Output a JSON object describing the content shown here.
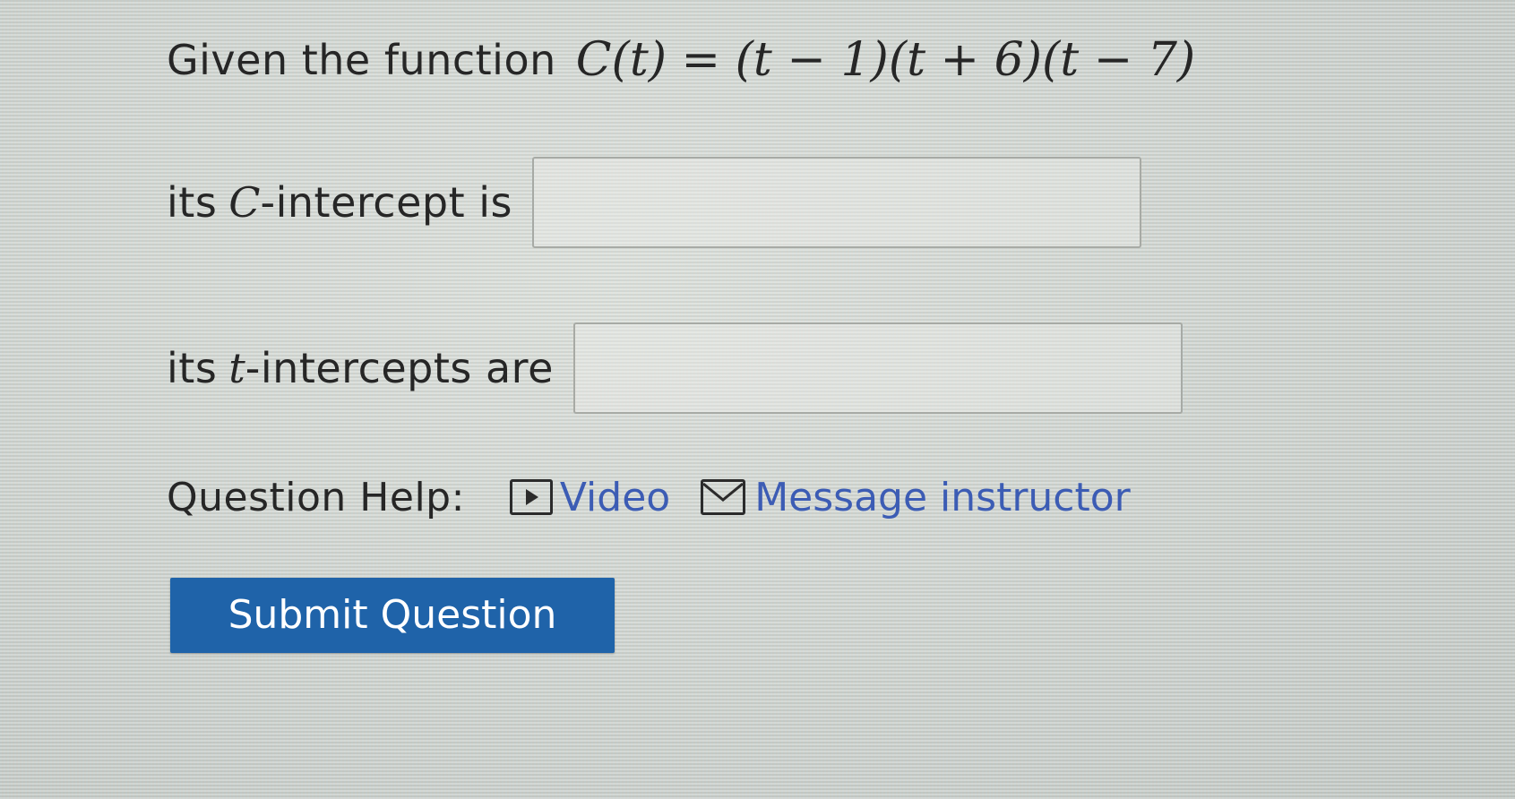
{
  "question": {
    "line1_text": "Given the function",
    "function_expression": "C(t) = (t − 1)(t + 6)(t − 7)",
    "line2_prefix": "its",
    "line2_var": "C",
    "line2_suffix": "-intercept is",
    "line3_prefix": "its",
    "line3_var": "t",
    "line3_suffix": "-intercepts are",
    "c_intercept_value": "",
    "t_intercepts_value": ""
  },
  "help": {
    "label": "Question Help:",
    "video_label": "Video",
    "message_label": "Message instructor",
    "video_icon": "video-play-icon",
    "message_icon": "envelope-icon"
  },
  "submit": {
    "label": "Submit Question"
  },
  "colors": {
    "link": "#3c5cb4",
    "button": "#1f63a9"
  }
}
